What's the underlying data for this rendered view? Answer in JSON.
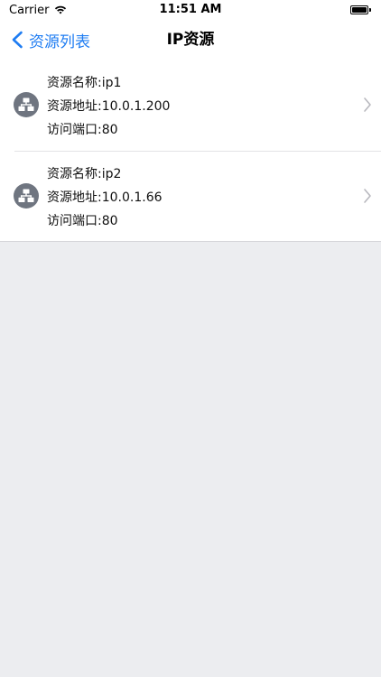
{
  "status_bar": {
    "carrier": "Carrier",
    "time": "11:51 AM",
    "wifi_icon": "wifi-icon",
    "battery_level": 1.0
  },
  "nav": {
    "back_label": "资源列表",
    "title": "IP资源",
    "accent_color": "#1E7CF2"
  },
  "resources": [
    {
      "icon": "network-icon",
      "name_line": "资源名称:ip1",
      "address_line": "资源地址:10.0.1.200",
      "port_line": "访问端口:80"
    },
    {
      "icon": "network-icon",
      "name_line": "资源名称:ip2",
      "address_line": "资源地址:10.0.1.66",
      "port_line": "访问端口:80"
    }
  ]
}
